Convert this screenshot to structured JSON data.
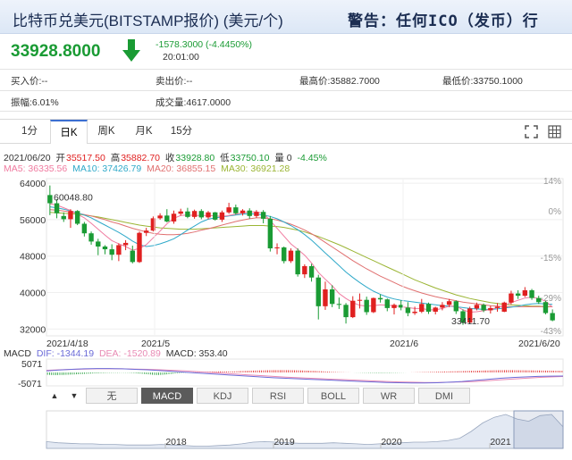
{
  "header": {
    "title": "比特币兑美元(BITSTAMP报价) (美元/个)",
    "warning": "警告：任何ICO（发币）行"
  },
  "quote": {
    "price": "33928.8000",
    "change": "-1578.3000 (-4.4450%)",
    "time": "20:01:00"
  },
  "info": {
    "bid": "买入价:--",
    "ask": "卖出价:--",
    "high": "最高价:35882.7000",
    "low": "最低价:33750.1000",
    "amplitude": "振幅:6.01%",
    "volume": "成交量:4617.0000"
  },
  "tabs": [
    "1分",
    "日K",
    "周K",
    "月K",
    "15分"
  ],
  "active_tab": "日K",
  "legend": {
    "date": "2021/06/20",
    "open_label": "开",
    "open": "35517.50",
    "high_label": "高",
    "high": "35882.70",
    "close_label": "收",
    "close": "33928.80",
    "low_label": "低",
    "low": "33750.10",
    "vol": "量 0",
    "pct": "-4.45%",
    "ma5": "MA5: 36335.56",
    "ma10": "MA10: 37426.79",
    "ma20": "MA20: 36855.15",
    "ma30": "MA30: 36921.28"
  },
  "macd_legend": {
    "label": "MACD",
    "dif": "DIF: -1344.19",
    "dea": "DEA: -1520.89",
    "macd": "MACD: 353.40"
  },
  "indicator_tabs": [
    "无",
    "MACD",
    "KDJ",
    "RSI",
    "BOLL",
    "WR",
    "DMI"
  ],
  "active_indicator": "MACD",
  "colors": {
    "up": "#e02020",
    "down": "#1a9b34",
    "ma5": "#f07ba0",
    "ma10": "#2fa9c9",
    "ma20": "#e07070",
    "ma30": "#9bb534",
    "dif": "#6b6bd8",
    "dea": "#e88ab4"
  },
  "chart_data": [
    {
      "type": "candlestick",
      "y_ticks": [
        "64000",
        "56000",
        "48000",
        "40000",
        "32000"
      ],
      "pct_ticks": [
        "14%",
        "0%",
        "-15%",
        "-29%",
        "-43%"
      ],
      "x_ticks": [
        "2021/4/18",
        "2021/5",
        "2021/6",
        "2021/6/20"
      ],
      "ylim": [
        30500,
        65000
      ],
      "annotations": [
        {
          "text": "60048.80",
          "value": 60048.8
        },
        {
          "text": "33411.70",
          "value": 33411.7
        }
      ],
      "candles": [
        [
          61400,
          63500,
          57000,
          59600
        ],
        [
          59600,
          60500,
          56300,
          57400
        ],
        [
          56800,
          57600,
          55500,
          56100
        ],
        [
          56100,
          58300,
          54200,
          57900
        ],
        [
          57900,
          58100,
          54800,
          55100
        ],
        [
          55100,
          55500,
          52300,
          53000
        ],
        [
          53000,
          53400,
          50500,
          51200
        ],
        [
          51200,
          51800,
          48200,
          50100
        ],
        [
          50100,
          50400,
          48400,
          49500
        ],
        [
          49500,
          50600,
          47100,
          48300
        ],
        [
          48300,
          50800,
          46900,
          50400
        ],
        [
          50400,
          51500,
          49300,
          50900
        ],
        [
          49200,
          50300,
          46400,
          46700
        ],
        [
          46700,
          53400,
          46500,
          53100
        ],
        [
          53100,
          54200,
          52400,
          53600
        ],
        [
          53600,
          56700,
          53400,
          56300
        ],
        [
          56300,
          57400,
          56000,
          56900
        ],
        [
          56900,
          58300,
          55400,
          55600
        ],
        [
          55600,
          58000,
          55100,
          57300
        ],
        [
          57300,
          58400,
          56900,
          57800
        ],
        [
          57800,
          58600,
          56300,
          56600
        ],
        [
          56600,
          58200,
          56200,
          57900
        ],
        [
          57900,
          58300,
          56100,
          56500
        ],
        [
          56500,
          57900,
          56100,
          57600
        ],
        [
          57600,
          57700,
          55800,
          56000
        ],
        [
          56000,
          58000,
          55500,
          57600
        ],
        [
          57600,
          59700,
          57300,
          58700
        ],
        [
          58700,
          59300,
          57100,
          57400
        ],
        [
          57400,
          58300,
          56900,
          58000
        ],
        [
          58000,
          58500,
          56200,
          56800
        ],
        [
          56800,
          58100,
          56400,
          57700
        ],
        [
          57700,
          58100,
          55200,
          56200
        ],
        [
          56200,
          56800,
          49000,
          49700
        ],
        [
          49700,
          50800,
          48400,
          49900
        ],
        [
          49900,
          50100,
          46400,
          46900
        ],
        [
          46900,
          49700,
          46500,
          49200
        ],
        [
          49200,
          49700,
          43500,
          44000
        ],
        [
          44000,
          46200,
          43200,
          45800
        ],
        [
          45800,
          46300,
          42400,
          43300
        ],
        [
          43300,
          43900,
          34100,
          37000
        ],
        [
          37000,
          42400,
          36200,
          40700
        ],
        [
          40700,
          41600,
          36800,
          37500
        ],
        [
          37500,
          38900,
          36400,
          37300
        ],
        [
          37300,
          37700,
          33200,
          34600
        ],
        [
          34600,
          39200,
          34400,
          38200
        ],
        [
          38200,
          39800,
          36500,
          38400
        ],
        [
          38400,
          39100,
          35100,
          35700
        ],
        [
          35700,
          38900,
          35500,
          38800
        ],
        [
          38800,
          39600,
          37800,
          38500
        ],
        [
          38500,
          38700,
          35900,
          36600
        ],
        [
          36600,
          37600,
          35200,
          37300
        ],
        [
          37300,
          38300,
          36100,
          36700
        ],
        [
          36700,
          37900,
          34800,
          35500
        ],
        [
          35500,
          36900,
          35100,
          35800
        ],
        [
          35800,
          38600,
          35500,
          37500
        ],
        [
          37500,
          37800,
          35300,
          35800
        ],
        [
          35800,
          36900,
          35200,
          36700
        ],
        [
          36700,
          37900,
          36100,
          37300
        ],
        [
          37300,
          38600,
          36800,
          38100
        ],
        [
          38100,
          38300,
          35300,
          35900
        ],
        [
          35900,
          36300,
          32900,
          33400
        ],
        [
          33400,
          36900,
          33300,
          36500
        ],
        [
          36500,
          37800,
          36100,
          37300
        ],
        [
          37300,
          37600,
          35700,
          36100
        ],
        [
          36100,
          37100,
          35400,
          36600
        ],
        [
          36600,
          37700,
          35800,
          36900
        ],
        [
          35800,
          38000,
          35700,
          37800
        ],
        [
          37800,
          40400,
          37400,
          39800
        ],
        [
          39800,
          40500,
          38600,
          39300
        ],
        [
          39300,
          41200,
          39000,
          40500
        ],
        [
          40500,
          40800,
          38400,
          38800
        ],
        [
          38800,
          39300,
          37500,
          37900
        ],
        [
          37900,
          38200,
          35200,
          35500
        ],
        [
          35500,
          36300,
          33700,
          33900
        ]
      ],
      "ma5": [
        59500,
        59200,
        58600,
        58000,
        57200,
        56400,
        55200,
        53900,
        52600,
        51400,
        50700,
        50100,
        49300,
        49700,
        50500,
        52000,
        53500,
        55100,
        56300,
        56900,
        57000,
        56900,
        56900,
        56900,
        56800,
        56700,
        56900,
        57200,
        57500,
        57700,
        57700,
        57400,
        55800,
        54100,
        52400,
        50700,
        49500,
        48200,
        46500,
        44400,
        42900,
        41500,
        39800,
        38700,
        37800,
        37200,
        37000,
        37100,
        37300,
        37200,
        37100,
        36900,
        36700,
        36500,
        36500,
        36200,
        36200,
        36500,
        37000,
        37000,
        36200,
        35700,
        35800,
        36000,
        36300,
        36700,
        37200,
        37800,
        38300,
        38800,
        39000,
        38700,
        38100,
        36800
      ],
      "ma10": [
        58800,
        58600,
        58300,
        57900,
        57500,
        57000,
        56400,
        55600,
        54800,
        54000,
        53200,
        52300,
        51300,
        50500,
        50100,
        50300,
        50700,
        51200,
        51800,
        52700,
        53700,
        54600,
        55500,
        56100,
        56400,
        56600,
        56800,
        57000,
        57200,
        57300,
        57200,
        57000,
        56700,
        56200,
        55500,
        54700,
        53800,
        52700,
        51500,
        50100,
        48700,
        47300,
        45900,
        44500,
        43300,
        42200,
        41200,
        40300,
        39600,
        39000,
        38600,
        38300,
        38100,
        37900,
        37700,
        37500,
        37300,
        37100,
        37000,
        36900,
        36700,
        36500,
        36400,
        36300,
        36300,
        36400,
        36600,
        36800,
        37000,
        37300,
        37500,
        37600,
        37500,
        37400
      ],
      "ma20": [
        58200,
        58100,
        57900,
        57700,
        57400,
        57100,
        56800,
        56400,
        56000,
        55500,
        55100,
        54600,
        54100,
        53700,
        53300,
        53000,
        52800,
        52700,
        52700,
        52800,
        53000,
        53300,
        53700,
        54000,
        54400,
        54800,
        55200,
        55600,
        55900,
        56200,
        56400,
        56400,
        56200,
        55900,
        55500,
        55000,
        54400,
        53700,
        52900,
        52000,
        51000,
        50000,
        49000,
        48000,
        47000,
        46100,
        45200,
        44400,
        43600,
        42900,
        42200,
        41500,
        40900,
        40400,
        39900,
        39500,
        39100,
        38800,
        38500,
        38200,
        37900,
        37700,
        37500,
        37300,
        37100,
        37000,
        36900,
        36900,
        36900,
        36900,
        36900,
        36900,
        36900,
        36900
      ],
      "ma30": [
        57600,
        57500,
        57400,
        57300,
        57200,
        57000,
        56800,
        56600,
        56300,
        56000,
        55700,
        55400,
        55100,
        54800,
        54600,
        54400,
        54200,
        54100,
        54000,
        53900,
        53900,
        53900,
        54000,
        54100,
        54200,
        54300,
        54400,
        54500,
        54600,
        54700,
        54700,
        54700,
        54600,
        54500,
        54300,
        54000,
        53700,
        53300,
        52800,
        52300,
        51700,
        51100,
        50500,
        49800,
        49100,
        48400,
        47700,
        47000,
        46300,
        45600,
        44900,
        44200,
        43500,
        42800,
        42200,
        41600,
        41000,
        40500,
        40000,
        39500,
        39100,
        38700,
        38400,
        38100,
        37800,
        37600,
        37400,
        37300,
        37200,
        37100,
        37000,
        37000,
        36900,
        36900
      ]
    },
    {
      "type": "bar",
      "title": "MACD",
      "y_ticks": [
        "5071",
        "-5071"
      ],
      "ylim": [
        -5071,
        5071
      ],
      "macd_bars": [
        -900,
        -950,
        -980,
        -1000,
        -1010,
        -1000,
        -980,
        -960,
        -930,
        -900,
        -860,
        -820,
        -780,
        -740,
        -700,
        -660,
        -620,
        -580,
        -540,
        -500,
        -460,
        -420,
        -380,
        -350,
        -310,
        -280,
        -250,
        -220,
        -190,
        -170,
        -150,
        -140,
        -130,
        -120,
        -110,
        -100,
        -95,
        -90,
        -100,
        -120,
        -150,
        -190,
        -240,
        -300,
        -360,
        -420,
        -490,
        -560,
        -640,
        -720,
        -800,
        -880,
        -950,
        -1000,
        -980,
        -940,
        -890,
        -820,
        -740,
        -650,
        -560,
        -470,
        -380,
        -300,
        -230,
        -170,
        -120,
        -80,
        -40,
        -10,
        20,
        60,
        100,
        140,
        180,
        220,
        260,
        300,
        330,
        360,
        380,
        400,
        410,
        420,
        430,
        420,
        410,
        400,
        390,
        380,
        370,
        400,
        450,
        500,
        550,
        580,
        620,
        650,
        680,
        700,
        720,
        740,
        760,
        780,
        800,
        820,
        840,
        850,
        860,
        870,
        880,
        890,
        900,
        900,
        900,
        900,
        895,
        890,
        880,
        870,
        850,
        830,
        810,
        790,
        760,
        730,
        700,
        680,
        650,
        620,
        580,
        540,
        500,
        460,
        420,
        380,
        340,
        300,
        260,
        220,
        180,
        150,
        120,
        100,
        80,
        60,
        40,
        20,
        0,
        -20,
        -40,
        -60,
        -80,
        -100,
        -120,
        -140,
        -150,
        -160,
        -170,
        -180,
        -190,
        -200,
        -200,
        -190,
        -180,
        -170,
        -160,
        -150,
        -140,
        -120,
        -100,
        -80,
        -60,
        -40,
        -20,
        0,
        20,
        40,
        60,
        80,
        100,
        120,
        140,
        160,
        180,
        200,
        220,
        240,
        260,
        280,
        300,
        320,
        340,
        360,
        380,
        400,
        420,
        440,
        460,
        480,
        500,
        520,
        540,
        560,
        580,
        600,
        620,
        640,
        660,
        680,
        700,
        720,
        740,
        760,
        780,
        800,
        820,
        840,
        850,
        860,
        870,
        880,
        890,
        900,
        900,
        890,
        880,
        870,
        860,
        850,
        840,
        830,
        820,
        810,
        800,
        790,
        780,
        770,
        760,
        750,
        740,
        730,
        720,
        710,
        700,
        690,
        680,
        670,
        660,
        650,
        640
      ],
      "dif": [
        600,
        900,
        1200,
        1400,
        1500,
        1500,
        1400,
        1200,
        1000,
        700,
        400,
        100,
        -200,
        -500,
        -800,
        -1100,
        -1400,
        -1700,
        -2000,
        -2200,
        -2400,
        -2600,
        -2800,
        -3000,
        -3200,
        -3400,
        -3600,
        -3800,
        -3900,
        -4000,
        -4000,
        -3900,
        -3700,
        -3400,
        -3000,
        -2600,
        -2200,
        -1900,
        -1700,
        -1500,
        -1400,
        -1344
      ],
      "dea": [
        800,
        1000,
        1200,
        1300,
        1400,
        1400,
        1400,
        1300,
        1200,
        1000,
        800,
        600,
        300,
        0,
        -300,
        -600,
        -900,
        -1200,
        -1500,
        -1800,
        -2000,
        -2200,
        -2400,
        -2600,
        -2800,
        -3000,
        -3200,
        -3400,
        -3600,
        -3700,
        -3800,
        -3800,
        -3700,
        -3600,
        -3400,
        -3100,
        -2800,
        -2500,
        -2200,
        -1900,
        -1700,
        -1521
      ]
    },
    {
      "type": "area",
      "x_ticks": [
        "2018",
        "2019",
        "2020",
        "2021"
      ],
      "values": [
        12,
        10,
        9,
        8,
        8,
        7,
        7,
        6,
        6,
        6,
        7,
        6,
        5,
        4,
        4,
        5,
        6,
        8,
        11,
        12,
        11,
        10,
        9,
        9,
        9,
        10,
        9,
        8,
        7,
        8,
        9,
        10,
        11,
        11,
        12,
        14,
        18,
        30,
        45,
        55,
        60,
        52,
        48,
        58,
        60,
        38
      ]
    }
  ]
}
